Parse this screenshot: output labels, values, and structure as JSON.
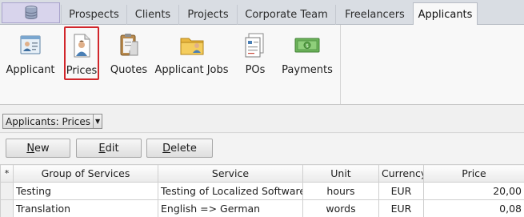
{
  "tabs": [
    {
      "label": "Prospects"
    },
    {
      "label": "Clients"
    },
    {
      "label": "Projects"
    },
    {
      "label": "Corporate Team"
    },
    {
      "label": "Freelancers"
    },
    {
      "label": "Applicants"
    }
  ],
  "active_tab": "Applicants",
  "ribbon": {
    "buttons": [
      {
        "label": "Applicant",
        "icon": "applicant-card-icon"
      },
      {
        "label": "Prices",
        "icon": "price-document-icon",
        "selected": true
      },
      {
        "label": "Quotes",
        "icon": "quotes-clipboard-icon"
      },
      {
        "label": "Applicant Jobs",
        "icon": "jobs-folder-icon"
      },
      {
        "label": "POs",
        "icon": "purchase-orders-icon"
      },
      {
        "label": "Payments",
        "icon": "payments-money-icon"
      }
    ]
  },
  "view_selector": {
    "value": "Applicants: Prices"
  },
  "actions": {
    "new_first": "N",
    "new_rest": "ew",
    "edit_first": "E",
    "edit_rest": "dit",
    "delete_first": "D",
    "delete_rest": "elete"
  },
  "grid": {
    "indicator": "*",
    "columns": [
      "Group of Services",
      "Service",
      "Unit",
      "Currency",
      "Price"
    ],
    "rows": [
      {
        "group": "Testing",
        "service": "Testing of Localized Software",
        "unit": "hours",
        "currency": "EUR",
        "price": "20,00"
      },
      {
        "group": "Translation",
        "service": "English => German",
        "unit": "words",
        "currency": "EUR",
        "price": "0,08"
      }
    ]
  },
  "colors": {
    "selected_outline": "#d1262b",
    "app_button": "#d8d4ec"
  }
}
